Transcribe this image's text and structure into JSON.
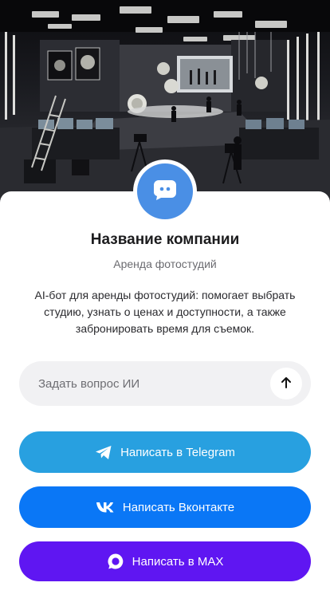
{
  "hero": {
    "image": "photo-studio-illustration"
  },
  "company": {
    "name": "Название компании",
    "subtitle": "Аренда фотостудий",
    "description": "AI-бот для аренды фотостудий: помогает выбрать студию, узнать о ценах и доступности, а также забронировать время для съемок."
  },
  "ask": {
    "placeholder": "Задать вопрос ИИ",
    "send_icon": "arrow-up-icon"
  },
  "buttons": {
    "telegram": {
      "label": "Написать в Telegram",
      "icon": "telegram-icon",
      "color": "#28a0e0"
    },
    "vk": {
      "label": "Написать Вконтакте",
      "icon": "vk-icon",
      "color": "#0a77f6"
    },
    "max": {
      "label": "Написать в MAX",
      "icon": "max-icon",
      "color": "#5f16f2"
    }
  },
  "colors": {
    "avatar": "#4a8fe5",
    "input_bg": "#f1f1f3"
  }
}
